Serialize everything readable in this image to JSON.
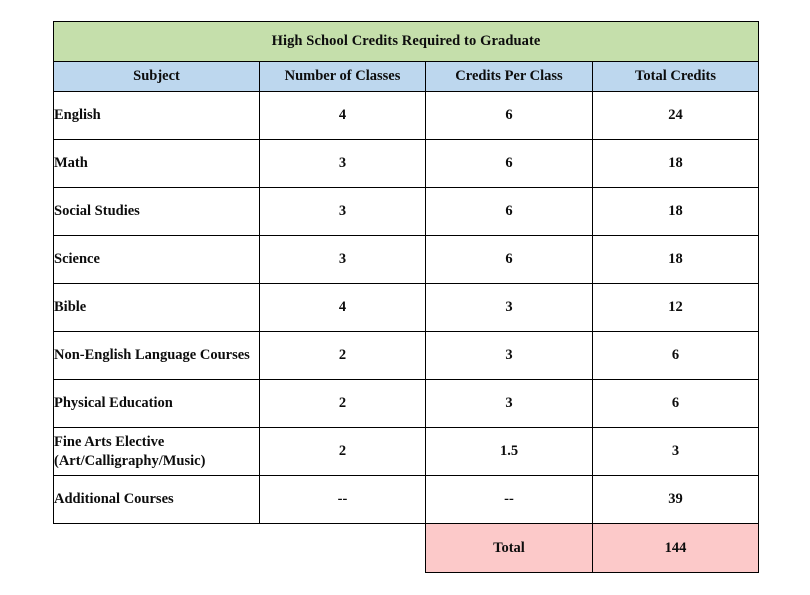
{
  "table": {
    "title": "High School Credits Required to Graduate",
    "columns": [
      "Subject",
      "Number of Classes",
      "Credits Per Class",
      "Total Credits"
    ],
    "rows": [
      {
        "subject": "English",
        "classes": "4",
        "credits_per_class": "6",
        "total_credits": "24"
      },
      {
        "subject": "Math",
        "classes": "3",
        "credits_per_class": "6",
        "total_credits": "18"
      },
      {
        "subject": "Social Studies",
        "classes": "3",
        "credits_per_class": "6",
        "total_credits": "18"
      },
      {
        "subject": "Science",
        "classes": "3",
        "credits_per_class": "6",
        "total_credits": "18"
      },
      {
        "subject": "Bible",
        "classes": "4",
        "credits_per_class": "3",
        "total_credits": "12"
      },
      {
        "subject": "Non-English Language Courses",
        "classes": "2",
        "credits_per_class": "3",
        "total_credits": "6"
      },
      {
        "subject": "Physical Education",
        "classes": "2",
        "credits_per_class": "3",
        "total_credits": "6"
      },
      {
        "subject": "Fine Arts Elective (Art/Calligraphy/Music)",
        "classes": "2",
        "credits_per_class": "1.5",
        "total_credits": "3"
      },
      {
        "subject": "Additional Courses",
        "classes": "--",
        "credits_per_class": "--",
        "total_credits": "39"
      }
    ],
    "total_row": {
      "label": "Total",
      "value": "144"
    },
    "colors": {
      "title_bg": "#c5dfab",
      "header_bg": "#bdd7ee",
      "total_bg": "#fcc9c9",
      "border": "#000000",
      "page_bg": "#ffffff"
    }
  },
  "chart_data": {
    "type": "table",
    "title": "High School Credits Required to Graduate",
    "columns": [
      "Subject",
      "Number of Classes",
      "Credits Per Class",
      "Total Credits"
    ],
    "rows": [
      [
        "English",
        "4",
        "6",
        "24"
      ],
      [
        "Math",
        "3",
        "6",
        "18"
      ],
      [
        "Social Studies",
        "3",
        "6",
        "18"
      ],
      [
        "Science",
        "3",
        "6",
        "18"
      ],
      [
        "Bible",
        "4",
        "3",
        "12"
      ],
      [
        "Non-English Language Courses",
        "2",
        "3",
        "6"
      ],
      [
        "Physical Education",
        "2",
        "3",
        "6"
      ],
      [
        "Fine Arts Elective (Art/Calligraphy/Music)",
        "2",
        "1.5",
        "3"
      ],
      [
        "Additional Courses",
        "--",
        "--",
        "39"
      ],
      [
        "",
        "",
        "Total",
        "144"
      ]
    ]
  }
}
